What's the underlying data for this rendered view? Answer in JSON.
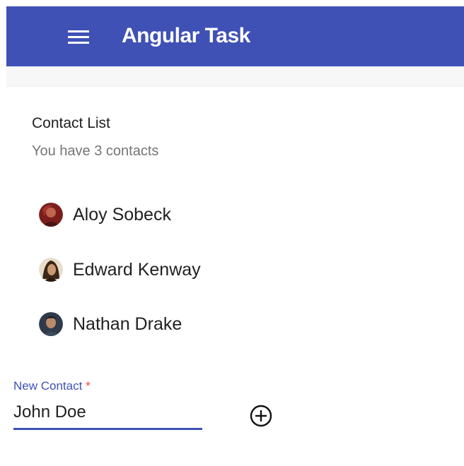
{
  "toolbar": {
    "title": "Angular Task",
    "menu_icon": "hamburger-menu-icon",
    "background": "#3f51b5"
  },
  "card": {
    "title": "Contact List",
    "subtitle": "You have 3 contacts"
  },
  "contacts": [
    {
      "name": "Aloy Sobeck",
      "avatar_icon": "avatar"
    },
    {
      "name": "Edward Kenway",
      "avatar_icon": "avatar"
    },
    {
      "name": "Nathan Drake",
      "avatar_icon": "avatar"
    }
  ],
  "new_contact": {
    "label": "New Contact",
    "required_marker": "*",
    "value": "John Doe",
    "add_icon": "add-circle-icon"
  }
}
